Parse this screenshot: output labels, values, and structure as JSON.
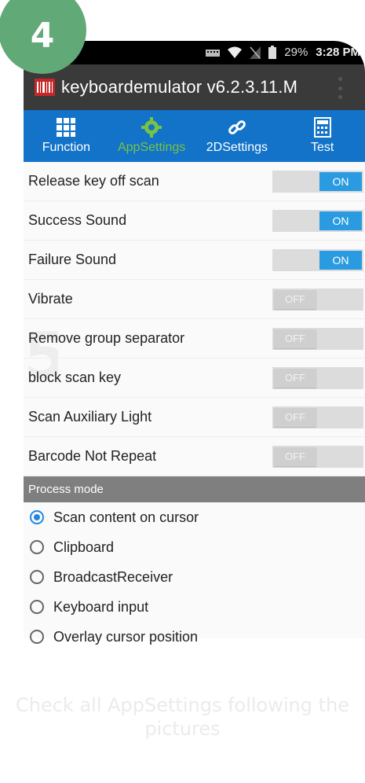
{
  "step": {
    "number": "4"
  },
  "status_bar": {
    "battery": "29%",
    "time": "3:28 PM"
  },
  "app_bar": {
    "title": "keyboardemulator v6.2.3.11.M"
  },
  "tabs": [
    {
      "label": "Function",
      "icon": "grid-icon"
    },
    {
      "label": "AppSettings",
      "icon": "gear-icon",
      "active": true
    },
    {
      "label": "2DSettings",
      "icon": "link-icon"
    },
    {
      "label": "Test",
      "icon": "calculator-icon"
    }
  ],
  "settings": [
    {
      "label": "Release key off scan",
      "state": "ON"
    },
    {
      "label": "Success Sound",
      "state": "ON"
    },
    {
      "label": "Failure Sound",
      "state": "ON"
    },
    {
      "label": "Vibrate",
      "state": "OFF"
    },
    {
      "label": "Remove group separator",
      "state": "OFF"
    },
    {
      "label": "block scan key",
      "state": "OFF"
    },
    {
      "label": "Scan Auxiliary Light",
      "state": "OFF"
    },
    {
      "label": "Barcode Not Repeat",
      "state": "OFF"
    }
  ],
  "process_mode": {
    "header": "Process mode",
    "options": [
      {
        "label": "Scan content on cursor",
        "checked": true
      },
      {
        "label": "Clipboard",
        "checked": false
      },
      {
        "label": "BroadcastReceiver",
        "checked": false
      },
      {
        "label": "Keyboard input",
        "checked": false
      },
      {
        "label": "Overlay cursor position",
        "checked": false
      }
    ]
  },
  "caption": {
    "line1": "Check all AppSettings following the",
    "line2": "pictures"
  },
  "colors": {
    "accent": "#1273c8",
    "active_tab": "#78c343",
    "toggle_on": "#2a9be0",
    "badge": "#62a978"
  }
}
